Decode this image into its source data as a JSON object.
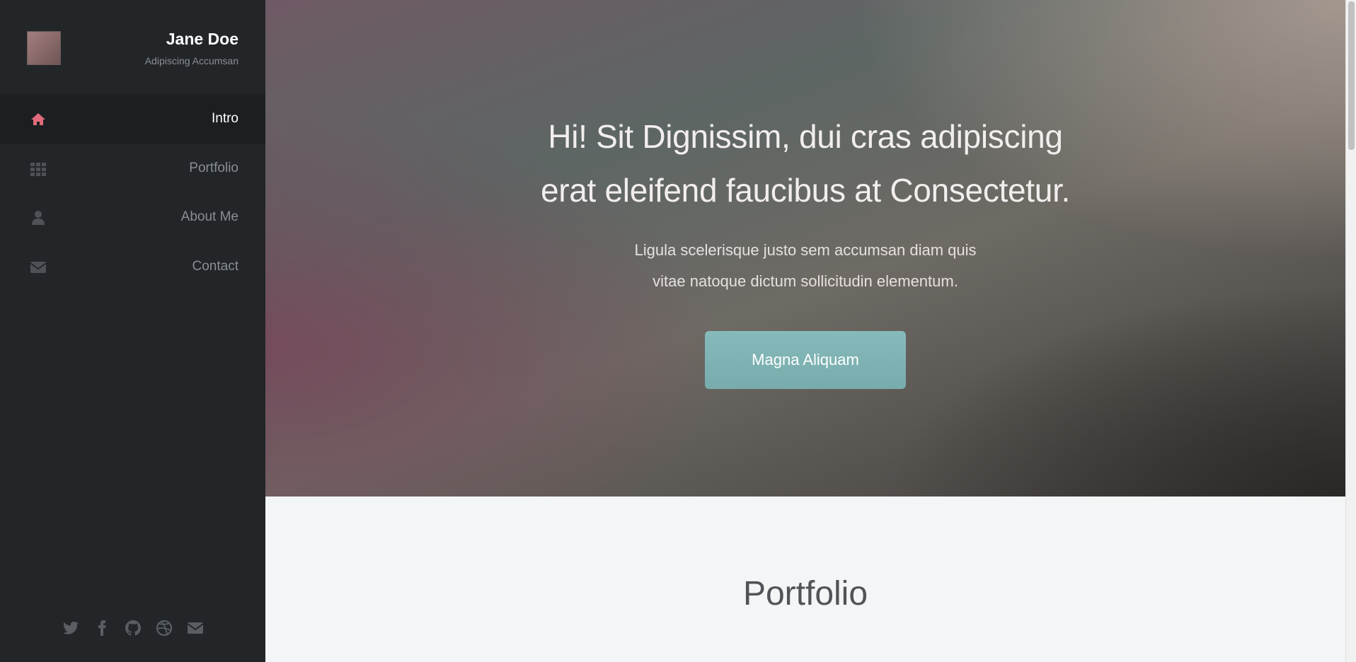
{
  "profile": {
    "name": "Jane Doe",
    "subtitle": "Adipiscing Accumsan"
  },
  "nav": {
    "items": [
      {
        "label": "Intro",
        "icon": "home-icon",
        "active": true
      },
      {
        "label": "Portfolio",
        "icon": "grid-icon",
        "active": false
      },
      {
        "label": "About Me",
        "icon": "user-icon",
        "active": false
      },
      {
        "label": "Contact",
        "icon": "envelope-icon",
        "active": false
      }
    ]
  },
  "social": [
    "twitter-icon",
    "facebook-icon",
    "github-icon",
    "dribbble-icon",
    "envelope-icon"
  ],
  "hero": {
    "title_line1": "Hi! Sit Dignissim, dui cras adipiscing",
    "title_line2": "erat eleifend faucibus at Consectetur.",
    "sub_line1": "Ligula scelerisque justo sem accumsan diam quis",
    "sub_line2": "vitae natoque dictum sollicitudin elementum.",
    "button_label": "Magna Aliquam"
  },
  "portfolio": {
    "title": "Portfolio"
  },
  "colors": {
    "sidebar_bg": "#222629",
    "accent_home_icon": "#e06a7a",
    "button": "#7fb3b3"
  }
}
